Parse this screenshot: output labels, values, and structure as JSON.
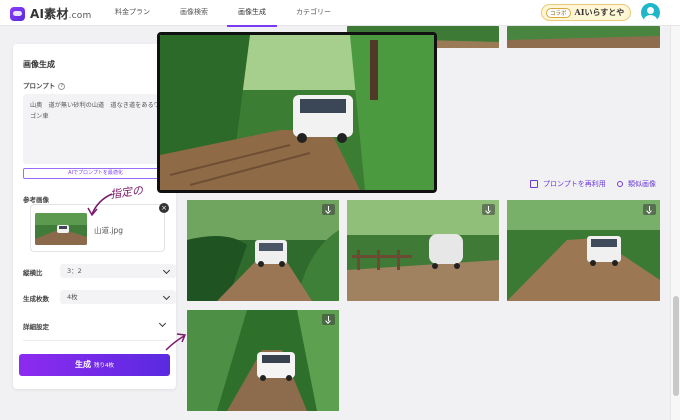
{
  "header": {
    "logo_text": "AI素材",
    "logo_domain": ".com",
    "nav": [
      "料金プラン",
      "画像検索",
      "画像生成",
      "カテゴリー"
    ],
    "active_nav": "画像生成",
    "collab_tag": "コラボ",
    "collab_text": "AIいらすとや"
  },
  "panel": {
    "title": "画像生成",
    "prompt_label": "プロンプト",
    "prompt_text": "山奥　道が無い砂利の山道　道なき道をあるワゴン車",
    "optimize_label": "AIでプロンプトを最適化",
    "reference_label": "参考画像",
    "reference_file": "山道.jpg",
    "aspect_label": "縦横比",
    "aspect_value": "3：2",
    "count_label": "生成枚数",
    "count_value": "4枚",
    "detail_label": "詳細設定",
    "generate_label": "生成",
    "generate_remaining": "残り4枚"
  },
  "gallery": {
    "reuse_label": "プロンプトを再利用",
    "similar_label": "類似画像"
  },
  "annotation": "指定の"
}
